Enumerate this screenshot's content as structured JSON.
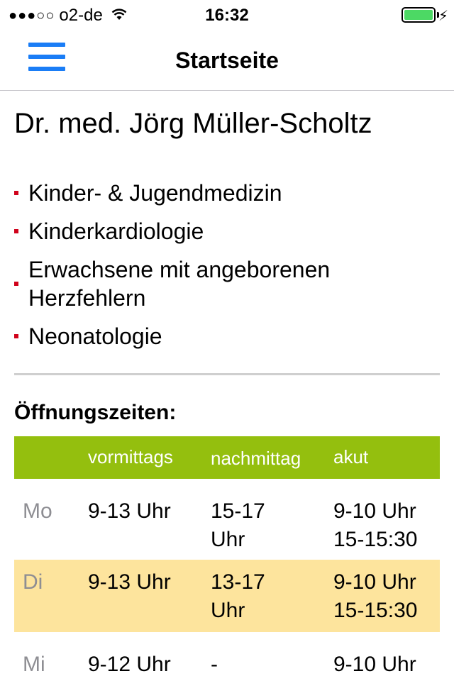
{
  "status_bar": {
    "signal": "●●●○○",
    "carrier": "o2-de",
    "time": "16:32",
    "battery_level": 1.0,
    "battery_color": "#4cd964",
    "charging_glyph": "⚡"
  },
  "nav": {
    "title": "Startseite",
    "menu_icon": "hamburger-menu-icon",
    "accent_color": "#1a7df6"
  },
  "doctor": {
    "name": "Dr. med. Jörg Müller-Scholtz"
  },
  "specialties": [
    "Kinder- & Jugendmedizin",
    "Kinderkardiologie",
    "Erwachsene mit angeborenen Herzfehlern",
    "Neonatologie"
  ],
  "hours": {
    "title": "Öffnungszeiten:",
    "header_color": "#94bf0e",
    "highlight_color": "#fde49d",
    "columns": [
      "",
      "vormittags",
      "nachmittags",
      "akut"
    ],
    "rows": [
      {
        "day": "Mo",
        "vormittags": "9-13 Uhr",
        "nachmittags": [
          "15-17",
          "Uhr"
        ],
        "akut": [
          "9-10 Uhr",
          "15-15:30"
        ],
        "highlighted": false
      },
      {
        "day": "Di",
        "vormittags": "9-13 Uhr",
        "nachmittags": [
          "13-17",
          "Uhr"
        ],
        "akut": [
          "9-10 Uhr",
          "15-15:30"
        ],
        "highlighted": true
      },
      {
        "day": "Mi",
        "vormittags": "9-12 Uhr",
        "nachmittags": [
          "-"
        ],
        "akut": [
          "9-10 Uhr"
        ],
        "highlighted": false
      }
    ]
  }
}
